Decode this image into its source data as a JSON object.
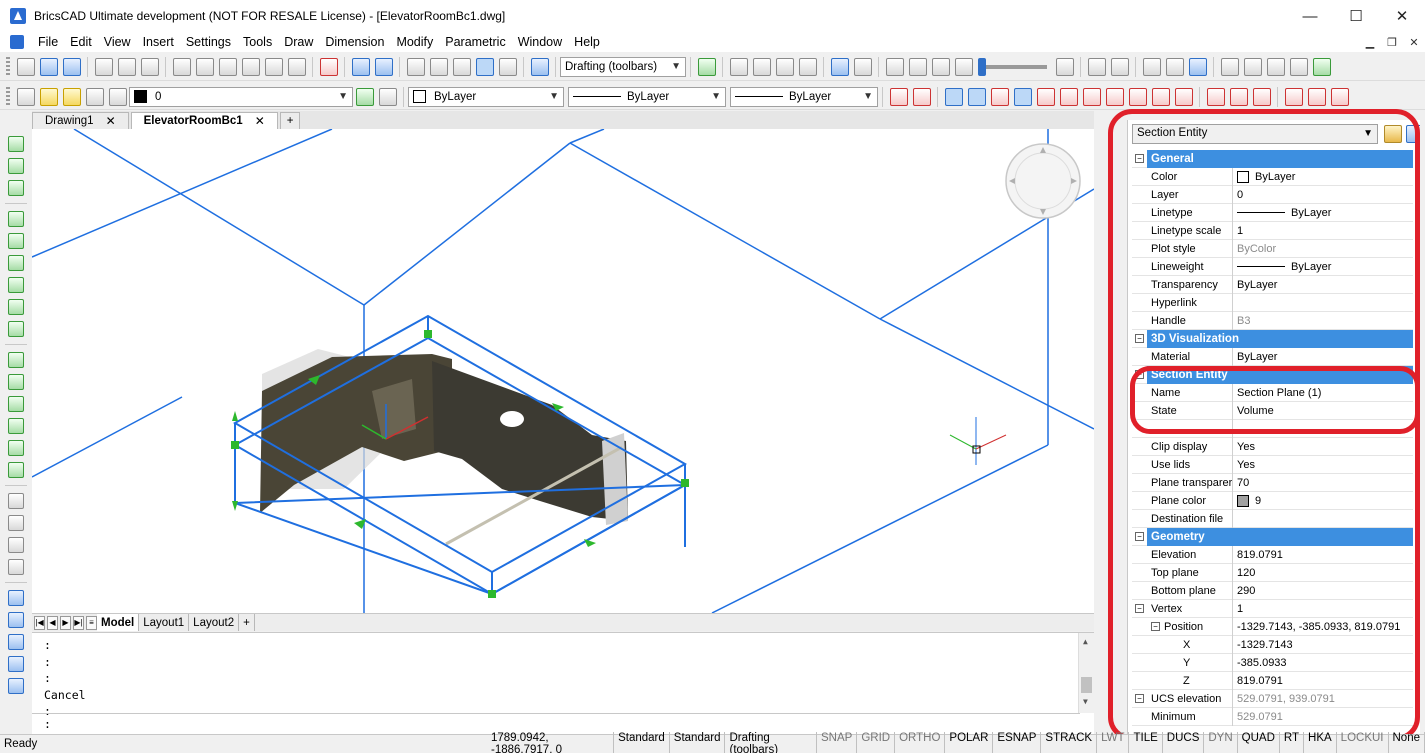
{
  "window": {
    "title": "BricsCAD Ultimate development (NOT FOR RESALE License) - [ElevatorRoomBc1.dwg]",
    "minimize": "—",
    "maximize": "☐",
    "close": "✕"
  },
  "menu": [
    "File",
    "Edit",
    "View",
    "Insert",
    "Settings",
    "Tools",
    "Draw",
    "Dimension",
    "Modify",
    "Parametric",
    "Window",
    "Help"
  ],
  "toolbar": {
    "workspace": "Drafting (toolbars)",
    "layer": "0",
    "color": "ByLayer",
    "linetype": "ByLayer",
    "lineweight": "ByLayer"
  },
  "doc_tabs": [
    {
      "label": "Drawing1",
      "active": false
    },
    {
      "label": "ElevatorRoomBc1",
      "active": true
    }
  ],
  "layout_tabs": [
    "Model",
    "Layout1",
    "Layout2"
  ],
  "command_history": [
    ":",
    ":",
    ":",
    "Cancel",
    ":"
  ],
  "command_prompt": ":",
  "properties": {
    "selector": "Section Entity",
    "rows": [
      {
        "type": "cat",
        "label": "General"
      },
      {
        "name": "Color",
        "value": "ByLayer",
        "swatch": "#ffffff"
      },
      {
        "name": "Layer",
        "value": "0"
      },
      {
        "name": "Linetype",
        "value": "ByLayer",
        "line": true
      },
      {
        "name": "Linetype scale",
        "value": "1"
      },
      {
        "name": "Plot style",
        "value": "ByColor",
        "grey": true
      },
      {
        "name": "Lineweight",
        "value": "ByLayer",
        "line": true
      },
      {
        "name": "Transparency",
        "value": "ByLayer"
      },
      {
        "name": "Hyperlink",
        "value": ""
      },
      {
        "name": "Handle",
        "value": "B3",
        "grey": true
      },
      {
        "type": "cat",
        "label": "3D Visualization"
      },
      {
        "name": "Material",
        "value": "ByLayer"
      },
      {
        "type": "cat",
        "label": "Section Entity"
      },
      {
        "name": "Name",
        "value": "Section Plane (1)"
      },
      {
        "name": "State",
        "value": "Volume"
      },
      {
        "type": "blank"
      },
      {
        "name": "Clip display",
        "value": "Yes"
      },
      {
        "name": "Use lids",
        "value": "Yes"
      },
      {
        "name": "Plane transparer",
        "value": "70"
      },
      {
        "name": "Plane color",
        "value": "9",
        "swatch": "#a0a0a0"
      },
      {
        "name": "Destination file",
        "value": ""
      },
      {
        "type": "cat",
        "label": "Geometry"
      },
      {
        "name": "Elevation",
        "value": "819.0791"
      },
      {
        "name": "Top plane",
        "value": "120"
      },
      {
        "name": "Bottom plane",
        "value": "290"
      },
      {
        "type": "group",
        "name": "Vertex",
        "value": "1"
      },
      {
        "type": "group2",
        "name": "Position",
        "value": "-1329.7143, -385.0933, 819.0791"
      },
      {
        "name": "X",
        "value": "-1329.7143",
        "indent": 2
      },
      {
        "name": "Y",
        "value": "-385.0933",
        "indent": 2
      },
      {
        "name": "Z",
        "value": "819.0791",
        "indent": 2
      },
      {
        "type": "group",
        "name": "UCS elevation",
        "value": "529.0791, 939.0791",
        "grey": true
      },
      {
        "name": "Minimum",
        "value": "529.0791",
        "grey": true,
        "indent": 1
      }
    ]
  },
  "status": {
    "ready": "Ready",
    "coords": "1789.0942, -1886.7917, 0",
    "fields": [
      "Standard",
      "Standard",
      "Drafting (toolbars)"
    ],
    "toggles": [
      {
        "label": "SNAP",
        "on": false
      },
      {
        "label": "GRID",
        "on": false
      },
      {
        "label": "ORTHO",
        "on": false
      },
      {
        "label": "POLAR",
        "on": true
      },
      {
        "label": "ESNAP",
        "on": true
      },
      {
        "label": "STRACK",
        "on": true
      },
      {
        "label": "LWT",
        "on": false
      },
      {
        "label": "TILE",
        "on": true
      },
      {
        "label": "DUCS",
        "on": true
      },
      {
        "label": "DYN",
        "on": false
      },
      {
        "label": "QUAD",
        "on": true
      },
      {
        "label": "RT",
        "on": true
      },
      {
        "label": "HKA",
        "on": true
      },
      {
        "label": "LOCKUI",
        "on": false
      },
      {
        "label": "None",
        "on": true
      }
    ]
  },
  "colors": {
    "wire": "#1f6fe0",
    "grip": "#2db82d",
    "category": "#3d8fe0",
    "annotation": "#e0202a"
  }
}
